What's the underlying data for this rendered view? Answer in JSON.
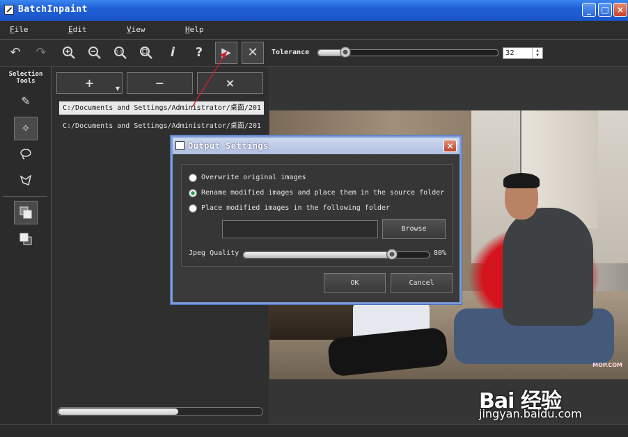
{
  "window": {
    "title": "BatchInpaint"
  },
  "menu": [
    "File",
    "Edit",
    "View",
    "Help"
  ],
  "toolbar": {
    "icons": [
      "undo-icon",
      "redo-icon",
      "zoom-in-icon",
      "zoom-out-icon",
      "zoom-actual-icon",
      "zoom-fit-icon",
      "info-icon",
      "help-icon",
      "run-icon",
      "stop-icon"
    ],
    "tolerance_label": "Tolerance",
    "tolerance_value": "32",
    "tolerance_fraction": 0.15
  },
  "tools": {
    "title_line1": "Selection",
    "title_line2": "Tools",
    "items": [
      "marker-icon",
      "magic-wand-icon",
      "lasso-icon",
      "polygon-lasso-icon",
      "layers-front-icon",
      "layers-back-icon"
    ]
  },
  "file_panel": {
    "add": "+",
    "remove": "−",
    "clear": "×",
    "files": [
      "C:/Documents and Settings/Administrator/桌面/201",
      "C:/Documents and Settings/Administrator/桌面/201"
    ]
  },
  "watermark": {
    "small": "MOP.COM",
    "brand": "Bai 经验",
    "url": "jingyan.baidu.com"
  },
  "dialog": {
    "title": "Output Settings",
    "options": [
      "Overwrite original images",
      "Rename modified images and place them in the source folder",
      "Place modified images in the following folder"
    ],
    "selected_option": 1,
    "folder_value": "",
    "browse": "Browse",
    "jpeg_label": "Jpeg Quality",
    "jpeg_value": "80%",
    "jpeg_fraction": 0.8,
    "ok": "OK",
    "cancel": "Cancel"
  },
  "colors": {
    "titlebar": "#1f5fd6",
    "dialog_border": "#7b9cd8",
    "annotation_arrow": "#d0202a"
  }
}
